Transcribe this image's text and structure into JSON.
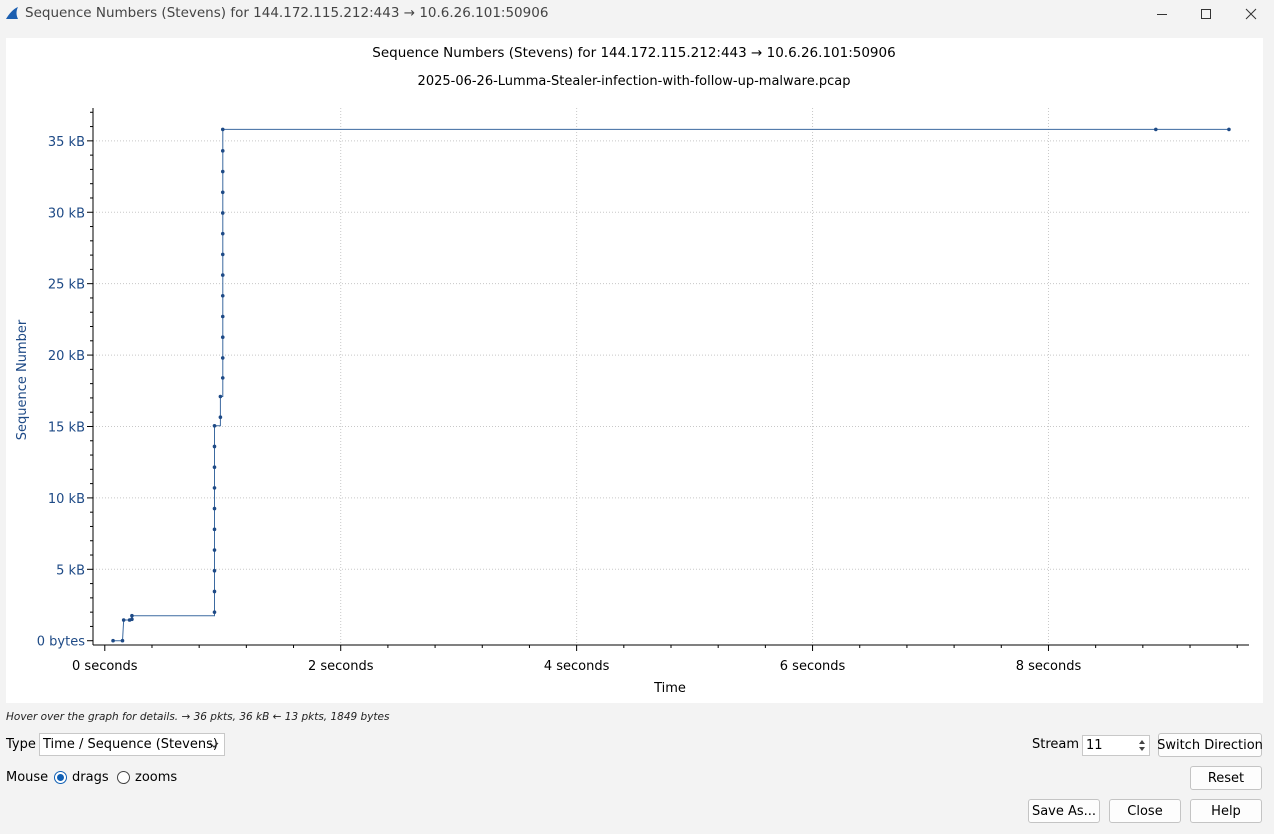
{
  "window": {
    "title": "Sequence Numbers (Stevens) for 144.172.115.212:443 → 10.6.26.101:50906",
    "minimize_glyph": "–",
    "maximize_glyph": "☐",
    "close_glyph": "✕",
    "app_icon": "wireshark-fin-icon"
  },
  "chart_data": {
    "type": "line",
    "title": "Sequence Numbers (Stevens) for 144.172.115.212:443 → 10.6.26.101:50906",
    "subtitle": "2025-06-26-Lumma-Stealer-infection-with-follow-up-malware.pcap",
    "xlabel": "Time",
    "ylabel": "Sequence Number",
    "xlim": [
      -0.1,
      9.7
    ],
    "ylim": [
      -300,
      37300
    ],
    "x_ticks": [
      0,
      2,
      4,
      6,
      8
    ],
    "x_tick_labels": [
      "0 seconds",
      "2 seconds",
      "4 seconds",
      "6 seconds",
      "8 seconds"
    ],
    "y_ticks": [
      0,
      5000,
      10000,
      15000,
      20000,
      25000,
      30000,
      35000
    ],
    "y_tick_labels": [
      "0 bytes",
      "5 kB",
      "10 kB",
      "15 kB",
      "20 kB",
      "25 kB",
      "30 kB",
      "35 kB"
    ],
    "grid": true,
    "color": "#3c6aa0",
    "series": [
      {
        "points": [
          [
            0.07,
            0
          ],
          [
            0.15,
            0
          ],
          [
            0.16,
            1450
          ],
          [
            0.21,
            1450
          ],
          [
            0.23,
            1500
          ],
          [
            0.23,
            1750
          ],
          [
            0.93,
            1750
          ],
          [
            0.93,
            2000
          ],
          [
            0.93,
            3450
          ],
          [
            0.93,
            4900
          ],
          [
            0.93,
            6350
          ],
          [
            0.93,
            7800
          ],
          [
            0.93,
            9250
          ],
          [
            0.93,
            10700
          ],
          [
            0.93,
            12150
          ],
          [
            0.93,
            13600
          ],
          [
            0.93,
            15050
          ],
          [
            0.98,
            15050
          ],
          [
            0.98,
            15650
          ],
          [
            0.98,
            17100
          ],
          [
            1.0,
            17100
          ],
          [
            1.0,
            18400
          ],
          [
            1.0,
            19800
          ],
          [
            1.0,
            21250
          ],
          [
            1.0,
            22700
          ],
          [
            1.0,
            24150
          ],
          [
            1.0,
            25600
          ],
          [
            1.0,
            27050
          ],
          [
            1.0,
            28500
          ],
          [
            1.0,
            29950
          ],
          [
            1.0,
            31400
          ],
          [
            1.0,
            32850
          ],
          [
            1.0,
            34300
          ],
          [
            1.0,
            35800
          ],
          [
            8.91,
            35800
          ],
          [
            9.53,
            35800
          ]
        ],
        "marked_points": [
          [
            0.07,
            0
          ],
          [
            0.15,
            0
          ],
          [
            0.16,
            1450
          ],
          [
            0.21,
            1450
          ],
          [
            0.23,
            1500
          ],
          [
            0.23,
            1750
          ],
          [
            0.93,
            2000
          ],
          [
            0.93,
            3450
          ],
          [
            0.93,
            4900
          ],
          [
            0.93,
            6350
          ],
          [
            0.93,
            7800
          ],
          [
            0.93,
            9250
          ],
          [
            0.93,
            10700
          ],
          [
            0.93,
            12150
          ],
          [
            0.93,
            13600
          ],
          [
            0.93,
            15050
          ],
          [
            0.98,
            15650
          ],
          [
            0.98,
            17100
          ],
          [
            1.0,
            18400
          ],
          [
            1.0,
            19800
          ],
          [
            1.0,
            21250
          ],
          [
            1.0,
            22700
          ],
          [
            1.0,
            24150
          ],
          [
            1.0,
            25600
          ],
          [
            1.0,
            27050
          ],
          [
            1.0,
            28500
          ],
          [
            1.0,
            29950
          ],
          [
            1.0,
            31400
          ],
          [
            1.0,
            32850
          ],
          [
            1.0,
            34300
          ],
          [
            1.0,
            35800
          ],
          [
            8.91,
            35800
          ],
          [
            9.53,
            35800
          ]
        ]
      }
    ]
  },
  "status": {
    "hover_text": "Hover over the graph for details. → 36 pkts, 36 kB ← 13 pkts, 1849 bytes"
  },
  "controls": {
    "type_label": "Type",
    "type_value": "Time / Sequence (Stevens)",
    "mouse_label": "Mouse",
    "drags_label": "drags",
    "drags_selected": true,
    "zooms_label": "zooms",
    "stream_label": "Stream",
    "stream_value": "11",
    "switch_direction": "Switch Direction",
    "reset": "Reset",
    "save_as": "Save As...",
    "close": "Close",
    "help": "Help"
  }
}
